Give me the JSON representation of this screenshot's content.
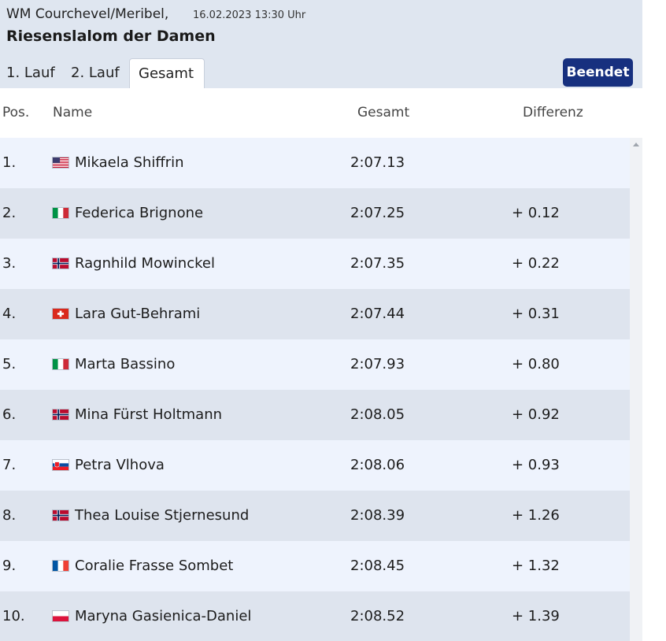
{
  "header": {
    "event": "WM Courchevel/Meribel,",
    "date": "16.02.2023 13:30 Uhr",
    "title": "Riesenslalom der Damen"
  },
  "tabs": [
    {
      "label": "1. Lauf",
      "active": false
    },
    {
      "label": "2. Lauf",
      "active": false
    },
    {
      "label": "Gesamt",
      "active": true
    }
  ],
  "status_label": "Beendet",
  "columns": {
    "pos": "Pos.",
    "name": "Name",
    "total": "Gesamt",
    "diff": "Differenz"
  },
  "rows": [
    {
      "pos": "1.",
      "country": "USA",
      "name": "Mikaela Shiffrin",
      "time": "2:07.13",
      "diff": ""
    },
    {
      "pos": "2.",
      "country": "ITA",
      "name": "Federica Brignone",
      "time": "2:07.25",
      "diff": "+ 0.12"
    },
    {
      "pos": "3.",
      "country": "NOR",
      "name": "Ragnhild Mowinckel",
      "time": "2:07.35",
      "diff": "+ 0.22"
    },
    {
      "pos": "4.",
      "country": "SUI",
      "name": "Lara Gut-Behrami",
      "time": "2:07.44",
      "diff": "+ 0.31"
    },
    {
      "pos": "5.",
      "country": "ITA",
      "name": "Marta Bassino",
      "time": "2:07.93",
      "diff": "+ 0.80"
    },
    {
      "pos": "6.",
      "country": "NOR",
      "name": "Mina Fürst Holtmann",
      "time": "2:08.05",
      "diff": "+ 0.92"
    },
    {
      "pos": "7.",
      "country": "SVK",
      "name": "Petra Vlhova",
      "time": "2:08.06",
      "diff": "+ 0.93"
    },
    {
      "pos": "8.",
      "country": "NOR",
      "name": "Thea Louise Stjernesund",
      "time": "2:08.39",
      "diff": "+ 1.26"
    },
    {
      "pos": "9.",
      "country": "FRA",
      "name": "Coralie Frasse Sombet",
      "time": "2:08.45",
      "diff": "+ 1.32"
    },
    {
      "pos": "10.",
      "country": "POL",
      "name": "Maryna Gasienica-Daniel",
      "time": "2:08.52",
      "diff": "+ 1.39"
    }
  ],
  "colors": {
    "header_bg": "#dfe6f0",
    "row_light": "#eef3fd",
    "row_dark": "#dee4ee",
    "status_button": "#17307f"
  }
}
